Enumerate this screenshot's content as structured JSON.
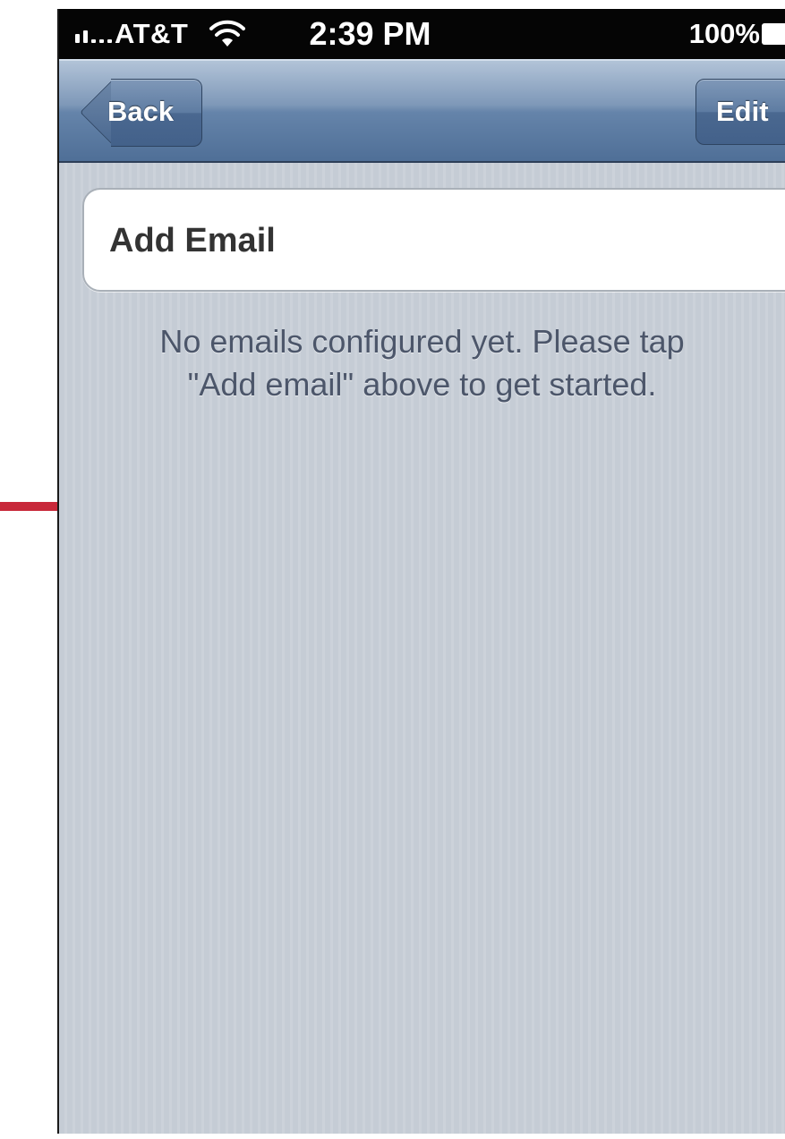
{
  "status_bar": {
    "carrier": "AT&T",
    "time": "2:39 PM",
    "battery": "100%",
    "icons": [
      "signal-icon",
      "wifi-icon",
      "battery-icon"
    ]
  },
  "nav_bar": {
    "back_label": "Back",
    "edit_label": "Edit"
  },
  "content": {
    "add_email_label": "Add Email",
    "empty_message_line1": "No emails configured yet. Please tap",
    "empty_message_line2": "\"Add email\" above to get started."
  },
  "colors": {
    "nav_bar": "#6584aa",
    "background": "#c5ccd5",
    "pointer": "#c8283a"
  }
}
